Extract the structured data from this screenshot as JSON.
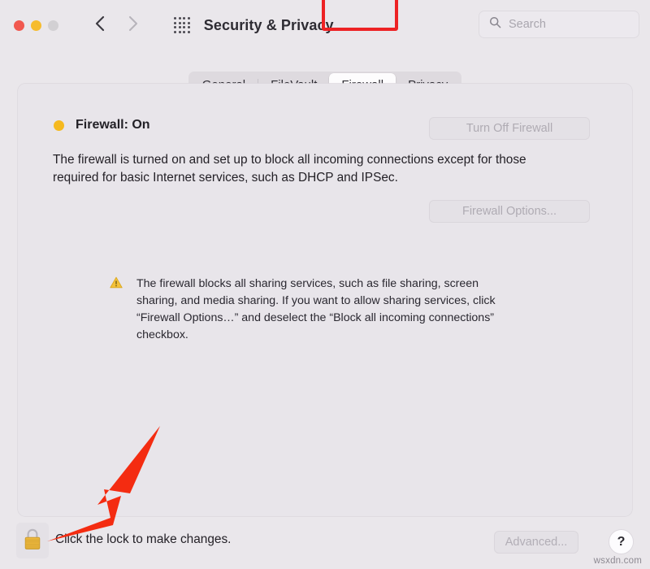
{
  "window": {
    "title": "Security & Privacy",
    "traffic_lights": [
      {
        "name": "close",
        "color": "#f1584f"
      },
      {
        "name": "minimize",
        "color": "#f6bc2e"
      },
      {
        "name": "zoom",
        "color": "#d2d0d3"
      }
    ],
    "nav": {
      "back_icon": "chevron-left",
      "forward_icon": "chevron-right"
    },
    "grid_icon": "show-all-preferences-grid"
  },
  "search": {
    "placeholder": "Search",
    "value": "",
    "icon": "search-icon"
  },
  "tabs": [
    {
      "label": "General",
      "selected": false
    },
    {
      "label": "FileVault",
      "selected": false
    },
    {
      "label": "Firewall",
      "selected": true
    },
    {
      "label": "Privacy",
      "selected": false
    }
  ],
  "firewall": {
    "status_dot_color": "#f5b91f",
    "status_label": "Firewall: On",
    "turn_off_button": "Turn Off Firewall",
    "options_button": "Firewall Options...",
    "description": "The firewall is turned on and set up to block all incoming connections except for those required for basic Internet services, such as DHCP and IPSec.",
    "warning_icon": "warning-triangle-icon",
    "warning_text": "The firewall blocks all sharing services, such as file sharing, screen sharing, and media sharing. If you want to allow sharing services, click “Firewall Options…” and deselect the “Block all incoming connections” checkbox."
  },
  "bottom_bar": {
    "lock_icon": "closed-padlock-icon",
    "lock_caption": "Click the lock to make changes.",
    "advanced_button": "Advanced...",
    "help_button": "?"
  },
  "annotation": {
    "arrow_color": "#f42c11",
    "highlight_color": "#ed2224",
    "arrow_target": "lock-button",
    "highlight_target": "tab-firewall"
  },
  "watermark": "wsxdn.com"
}
